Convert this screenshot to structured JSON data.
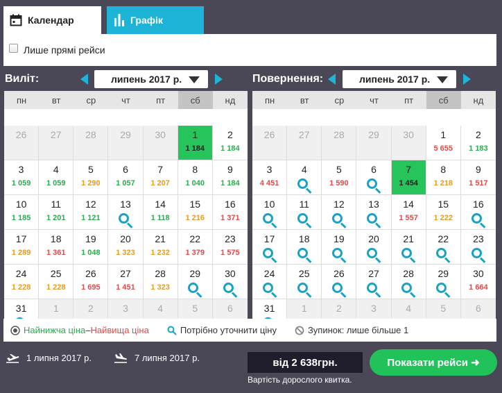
{
  "tabs": {
    "calendar_label": "Календар",
    "graph_label": "Графік"
  },
  "direct_only": {
    "label": "Лише прямі рейси",
    "checked": false
  },
  "weekdays": [
    "пн",
    "вт",
    "ср",
    "чт",
    "пт",
    "сб",
    "нд"
  ],
  "depart": {
    "label": "Виліт:",
    "month": "липень 2017 р.",
    "cells": [
      {
        "day": "26",
        "out": true
      },
      {
        "day": "27",
        "out": true
      },
      {
        "day": "28",
        "out": true
      },
      {
        "day": "29",
        "out": true
      },
      {
        "day": "30",
        "out": true
      },
      {
        "day": "1",
        "price": "1 184",
        "color": "g",
        "selected": true
      },
      {
        "day": "2",
        "price": "1 184",
        "color": "g"
      },
      {
        "day": "3",
        "price": "1 059",
        "color": "g"
      },
      {
        "day": "4",
        "price": "1 059",
        "color": "g"
      },
      {
        "day": "5",
        "price": "1 290",
        "color": "o"
      },
      {
        "day": "6",
        "price": "1 057",
        "color": "g"
      },
      {
        "day": "7",
        "price": "1 207",
        "color": "o"
      },
      {
        "day": "8",
        "price": "1 040",
        "color": "g"
      },
      {
        "day": "9",
        "price": "1 184",
        "color": "g"
      },
      {
        "day": "10",
        "price": "1 185",
        "color": "g"
      },
      {
        "day": "11",
        "price": "1 201",
        "color": "g"
      },
      {
        "day": "12",
        "price": "1 121",
        "color": "g"
      },
      {
        "day": "13",
        "search": true
      },
      {
        "day": "14",
        "price": "1 118",
        "color": "g"
      },
      {
        "day": "15",
        "price": "1 216",
        "color": "o"
      },
      {
        "day": "16",
        "price": "1 371",
        "color": "r"
      },
      {
        "day": "17",
        "price": "1 289",
        "color": "o"
      },
      {
        "day": "18",
        "price": "1 361",
        "color": "r"
      },
      {
        "day": "19",
        "price": "1 048",
        "color": "g"
      },
      {
        "day": "20",
        "price": "1 323",
        "color": "o"
      },
      {
        "day": "21",
        "price": "1 232",
        "color": "o"
      },
      {
        "day": "22",
        "price": "1 379",
        "color": "r"
      },
      {
        "day": "23",
        "price": "1 575",
        "color": "r"
      },
      {
        "day": "24",
        "price": "1 228",
        "color": "o"
      },
      {
        "day": "25",
        "price": "1 228",
        "color": "o"
      },
      {
        "day": "26",
        "price": "1 695",
        "color": "r"
      },
      {
        "day": "27",
        "price": "1 451",
        "color": "r"
      },
      {
        "day": "28",
        "price": "1 323",
        "color": "o"
      },
      {
        "day": "29",
        "search": true
      },
      {
        "day": "30",
        "search": true
      },
      {
        "day": "31",
        "search": true
      },
      {
        "day": "1",
        "out": true
      },
      {
        "day": "2",
        "out": true
      },
      {
        "day": "3",
        "out": true
      },
      {
        "day": "4",
        "out": true
      },
      {
        "day": "5",
        "out": true
      },
      {
        "day": "6",
        "out": true
      }
    ]
  },
  "return": {
    "label": "Повернення:",
    "month": "липень 2017 р.",
    "cells": [
      {
        "day": "26",
        "out": true
      },
      {
        "day": "27",
        "out": true
      },
      {
        "day": "28",
        "out": true
      },
      {
        "day": "29",
        "out": true
      },
      {
        "day": "30",
        "out": true
      },
      {
        "day": "1",
        "price": "5 655",
        "color": "r"
      },
      {
        "day": "2",
        "price": "1 183",
        "color": "g"
      },
      {
        "day": "3",
        "price": "4 451",
        "color": "r"
      },
      {
        "day": "4",
        "search": true
      },
      {
        "day": "5",
        "price": "1 590",
        "color": "r"
      },
      {
        "day": "6",
        "search": true
      },
      {
        "day": "7",
        "price": "1 454",
        "color": "g",
        "selected": true
      },
      {
        "day": "8",
        "price": "1 218",
        "color": "o"
      },
      {
        "day": "9",
        "price": "1 517",
        "color": "r"
      },
      {
        "day": "10",
        "search": true
      },
      {
        "day": "11",
        "search": true
      },
      {
        "day": "12",
        "search": true
      },
      {
        "day": "13",
        "search": true
      },
      {
        "day": "14",
        "price": "1 557",
        "color": "r"
      },
      {
        "day": "15",
        "price": "1 222",
        "color": "o"
      },
      {
        "day": "16",
        "search": true
      },
      {
        "day": "17",
        "search": true
      },
      {
        "day": "18",
        "search": true
      },
      {
        "day": "19",
        "search": true
      },
      {
        "day": "20",
        "search": true
      },
      {
        "day": "21",
        "search": true
      },
      {
        "day": "22",
        "search": true
      },
      {
        "day": "23",
        "search": true
      },
      {
        "day": "24",
        "search": true
      },
      {
        "day": "25",
        "search": true
      },
      {
        "day": "26",
        "search": true
      },
      {
        "day": "27",
        "search": true
      },
      {
        "day": "28",
        "search": true
      },
      {
        "day": "29",
        "search": true
      },
      {
        "day": "30",
        "price": "1 664",
        "color": "r"
      },
      {
        "day": "31",
        "search": true
      },
      {
        "day": "1",
        "out": true
      },
      {
        "day": "2",
        "out": true
      },
      {
        "day": "3",
        "out": true
      },
      {
        "day": "4",
        "out": true
      },
      {
        "day": "5",
        "out": true
      },
      {
        "day": "6",
        "out": true
      }
    ]
  },
  "legend": {
    "lowest": "Найнижча ціна",
    "dash": " – ",
    "highest": "Найвища ціна",
    "check_price": "Потрібно уточнити ціну",
    "stops": "Зупинок: лише більше 1"
  },
  "footer": {
    "depart_date": "1 липня 2017 р.",
    "return_date": "7 липня 2017 р.",
    "price": "від 2 638грн.",
    "price_note": "Вартість дорослого квитка.",
    "show_button": "Показати рейси ➜"
  },
  "colors": {
    "accent": "#1db4d7",
    "green": "#27c35b",
    "price_green": "#2eaa4f",
    "price_orange": "#e59b1f",
    "price_red": "#de4b4b",
    "background": "#4a4757"
  }
}
